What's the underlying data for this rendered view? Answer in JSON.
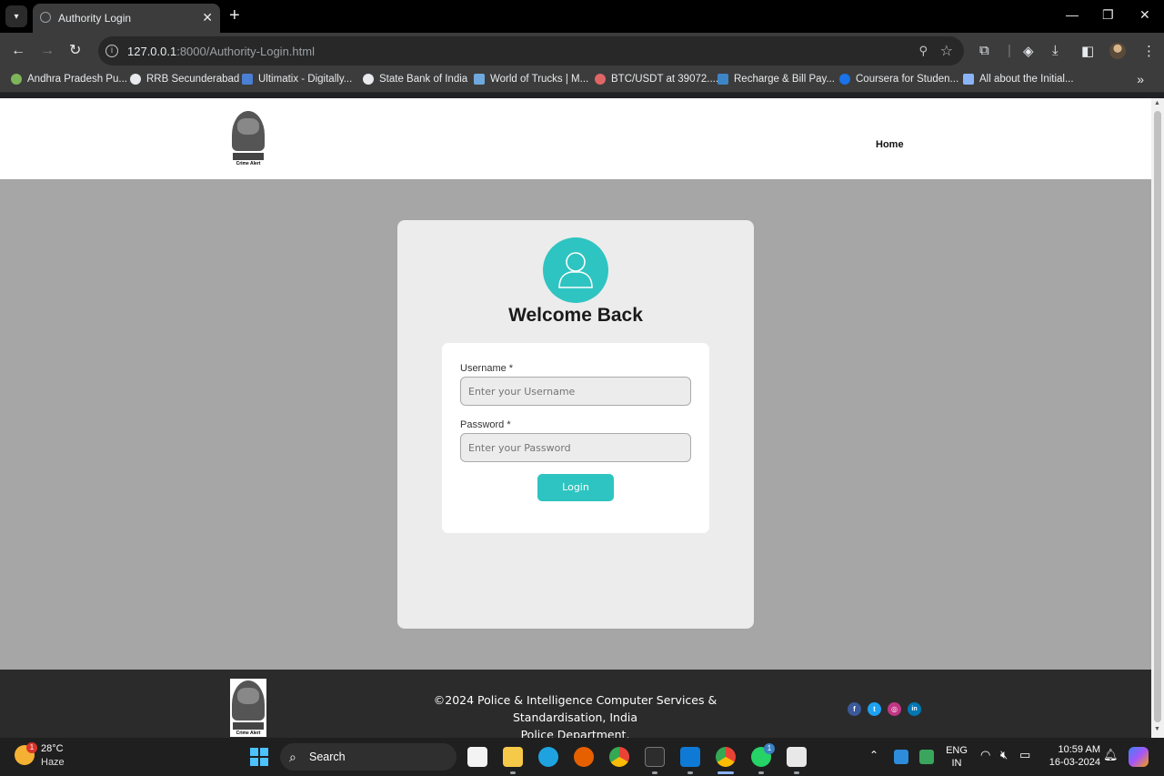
{
  "browser": {
    "tab_title": "Authority Login",
    "new_tab_symbol": "+",
    "url_host": "127.0.0.1",
    "url_path": ":8000/Authority-Login.html",
    "bookmarks": [
      {
        "label": "Andhra Pradesh Pu...",
        "color": "#7fb55a"
      },
      {
        "label": "RRB Secunderabad",
        "color": "#e8eaed"
      },
      {
        "label": "Ultimatix - Digitally...",
        "color": "#4a7fd4"
      },
      {
        "label": "State Bank of India",
        "color": "#e8eaed"
      },
      {
        "label": "World of Trucks | M...",
        "color": "#6fa8dc"
      },
      {
        "label": "BTC/USDT at 39072....",
        "color": "#e06666"
      },
      {
        "label": "Recharge & Bill Pay...",
        "color": "#3d85c6"
      },
      {
        "label": "Coursera for Studen...",
        "color": "#1a73e8"
      },
      {
        "label": "All about the Initial...",
        "color": "#8ab4f8"
      }
    ]
  },
  "site": {
    "logo_caption": "Crime Alert",
    "nav_home": "Home"
  },
  "login": {
    "heading": "Welcome Back",
    "username_label": "Username *",
    "username_placeholder": "Enter your Username",
    "password_label": "Password *",
    "password_placeholder": "Enter your Password",
    "button": "Login"
  },
  "footer": {
    "line1": "©2024 Police & Intelligence Computer Services & Standardisation, India",
    "line2": "Police Department.",
    "social": [
      {
        "name": "facebook",
        "glyph": "f",
        "color": "#3b5998"
      },
      {
        "name": "twitter",
        "glyph": "t",
        "color": "#1da1f2"
      },
      {
        "name": "instagram",
        "glyph": "◎",
        "color": "#c13584"
      },
      {
        "name": "linkedin",
        "glyph": "in",
        "color": "#0077b5"
      }
    ]
  },
  "taskbar": {
    "weather_temp": "28°C",
    "weather_condition": "Haze",
    "weather_badge": "1",
    "search_label": "Search",
    "lang_line1": "ENG",
    "lang_line2": "IN",
    "time": "10:59 AM",
    "date": "16-03-2024",
    "whatsapp_badge": "1"
  }
}
